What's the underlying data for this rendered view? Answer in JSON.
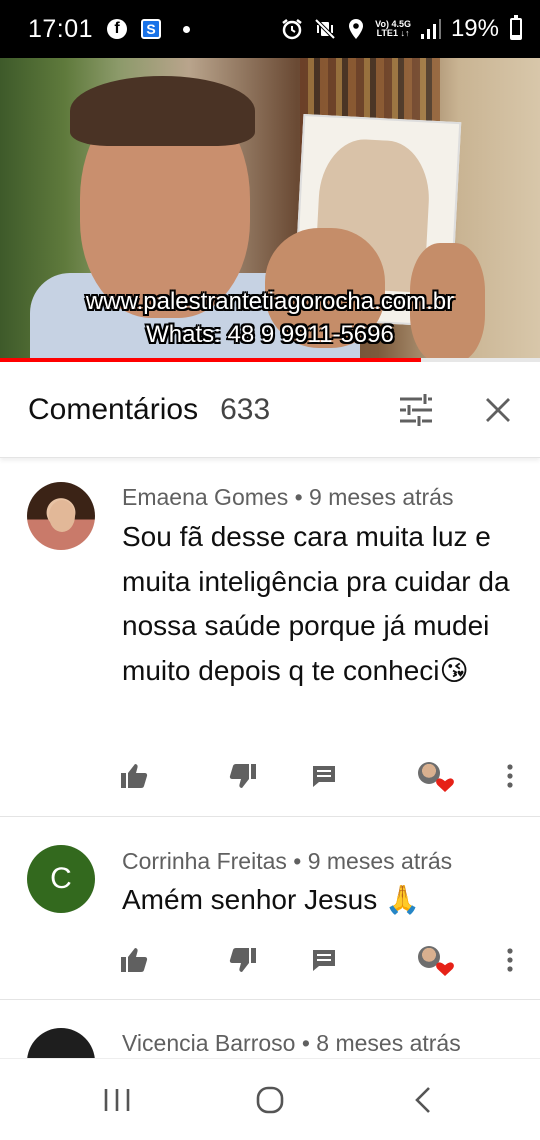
{
  "status_bar": {
    "time": "17:01",
    "network_top": "Vo) 4.5G",
    "network_bottom": "LTE1 ↓↑",
    "battery_percent": "19%",
    "battery_level": 0.19,
    "icons": [
      "facebook-icon",
      "s-app-icon",
      "dot-icon",
      "alarm-icon",
      "vibrate-mute-icon",
      "location-icon",
      "signal-icon",
      "battery-icon"
    ]
  },
  "video": {
    "caption_line1": "www.palestrantetiagorocha.com.br",
    "caption_line2": "Whats: 48 9 9911-5696",
    "progress": 0.78,
    "progress_color": "#ff0000"
  },
  "comments_header": {
    "title": "Comentários",
    "count": "633",
    "icons": [
      "sort-filter-icon",
      "close-icon"
    ]
  },
  "comments": [
    {
      "author": "Emaena Gomes",
      "time": "9 meses atrás",
      "meta": "Emaena Gomes • 9 meses atrás",
      "text": "Sou fã desse cara muita luz e muita inteligência pra cuidar da nossa saúde porque já mudei muito depois q te conheci😘",
      "avatar_type": "photo"
    },
    {
      "author": "Corrinha Freitas",
      "time": "9 meses atrás",
      "meta": "Corrinha Freitas • 9 meses atrás",
      "text": "Amém senhor Jesus 🙏",
      "avatar_type": "letter",
      "avatar_letter": "C",
      "avatar_color": "#33691e"
    },
    {
      "author": "Vicencia Barroso",
      "time": "8 meses atrás",
      "meta": "Vicencia Barroso • 8 meses atrás",
      "avatar_type": "photo"
    }
  ],
  "action_icons": [
    "like-icon",
    "dislike-icon",
    "reply-icon",
    "creator-heart-icon",
    "more-options-icon"
  ],
  "nav_bar": {
    "icons": [
      "recent-apps-icon",
      "home-icon",
      "back-icon"
    ]
  }
}
